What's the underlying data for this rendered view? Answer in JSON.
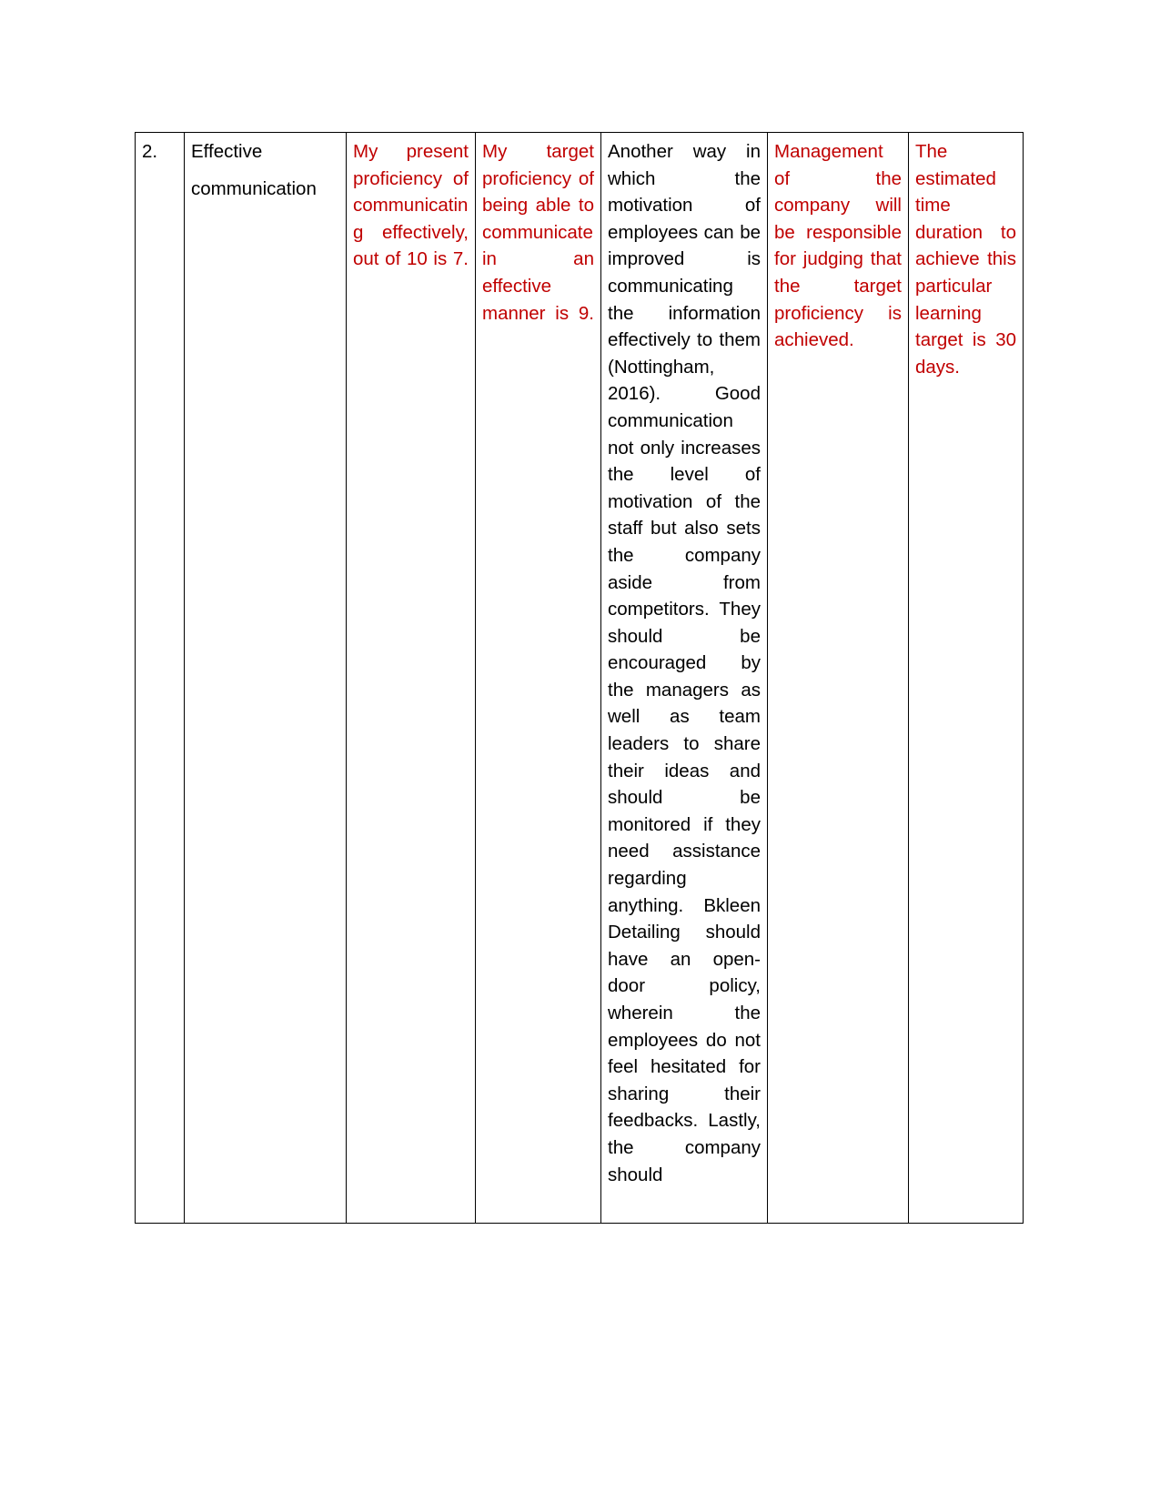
{
  "document": {
    "type": "table",
    "page_background": "#ffffff",
    "red_text_color": "#C00000",
    "black_text_color": "#000000"
  },
  "table": {
    "columns": [
      "serial-number",
      "learning-objective",
      "present-proficiency",
      "target-proficiency",
      "development-opportunities",
      "criteria-for-judging-success",
      "time-frame"
    ],
    "rows": [
      {
        "serial_number": "2.",
        "skill_name_line1": "Effective",
        "skill_name_line2": "communication",
        "present_proficiency": "My present proficiency of communicating effectively, out of 10 is 7.",
        "target_proficiency": "My target proficiency of being able to communicate in an effective manner is 9.",
        "development_opportunities": "Another way in which the motivation of employees can be improved is communicating the information effectively to them (Nottingham, 2016). Good communication not only increases the level of motivation of the staff but also sets the company aside from competitors. They should be encouraged by the managers as well as team leaders to share their ideas and should be monitored if they need assistance regarding anything. Bkleen Detailing should have an open-door policy, wherein the employees do not feel hesitated for sharing their feedbacks. Lastly, the company should",
        "criteria_for_judging": "Management of the company will be responsible for judging that the target proficiency is achieved.",
        "time_frame": "The estimated time duration to achieve this particular learning target is 30 days."
      }
    ]
  }
}
